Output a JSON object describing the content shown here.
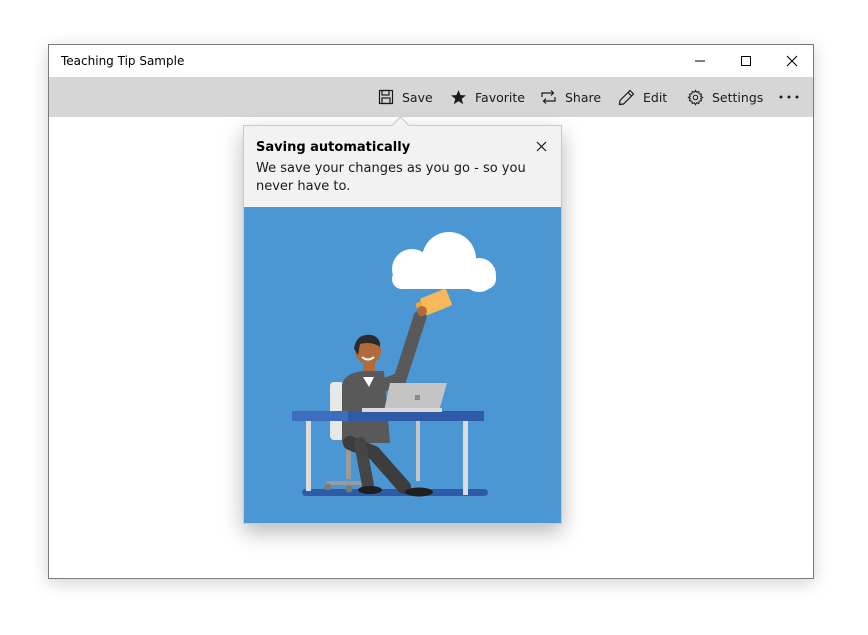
{
  "window": {
    "title": "Teaching Tip Sample"
  },
  "toolbar": {
    "items": [
      {
        "label": "Save",
        "icon": "save-icon"
      },
      {
        "label": "Favorite",
        "icon": "star-icon"
      },
      {
        "label": "Share",
        "icon": "share-icon"
      },
      {
        "label": "Edit",
        "icon": "pencil-icon"
      },
      {
        "label": "Settings",
        "icon": "gear-icon"
      }
    ],
    "more_label": "···"
  },
  "teaching_tip": {
    "title": "Saving automatically",
    "subtitle": "We save your changes as you go - so you never have to."
  },
  "colors": {
    "command_bar": "#d6d6d6",
    "tip_background": "#f2f2f2",
    "hero_background": "#4a97d3",
    "accent_orange": "#f2a33a",
    "desk_blue": "#2e5aa8"
  }
}
